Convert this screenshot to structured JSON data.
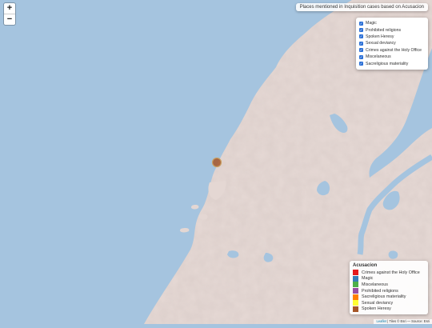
{
  "map": {
    "title": "Places mentioned in Inquisition cases based on Acusacion",
    "zoom_in": "+",
    "zoom_out": "−"
  },
  "layers": [
    {
      "label": "Magic",
      "checked": true
    },
    {
      "label": "Prohibited religions",
      "checked": true
    },
    {
      "label": "Spoken Heresy",
      "checked": true
    },
    {
      "label": "Sexual deviancy",
      "checked": true
    },
    {
      "label": "Crimes against the Holy Office",
      "checked": true
    },
    {
      "label": "Miscelaneous",
      "checked": true
    },
    {
      "label": "Sacreligious materiality",
      "checked": true
    }
  ],
  "legend": {
    "title": "Acusacion",
    "items": [
      {
        "label": "Crimes against the Holy Office",
        "color": "#e41a1c"
      },
      {
        "label": "Magic",
        "color": "#377eb8"
      },
      {
        "label": "Miscelaneous",
        "color": "#4daf4a"
      },
      {
        "label": "Prohibited religions",
        "color": "#984ea3"
      },
      {
        "label": "Sacreligious materiality",
        "color": "#ff7f00"
      },
      {
        "label": "Sexual deviancy",
        "color": "#ffff33"
      },
      {
        "label": "Spoken Heresy",
        "color": "#a65628"
      }
    ]
  },
  "marker": {
    "category": "Spoken Heresy",
    "color": "#a65628"
  },
  "attribution": {
    "leaflet": "Leaflet",
    "text": " | Tiles © Esri — Source: Esri"
  },
  "colors": {
    "water": "#a5c4df",
    "land": "#e4d7d3"
  }
}
